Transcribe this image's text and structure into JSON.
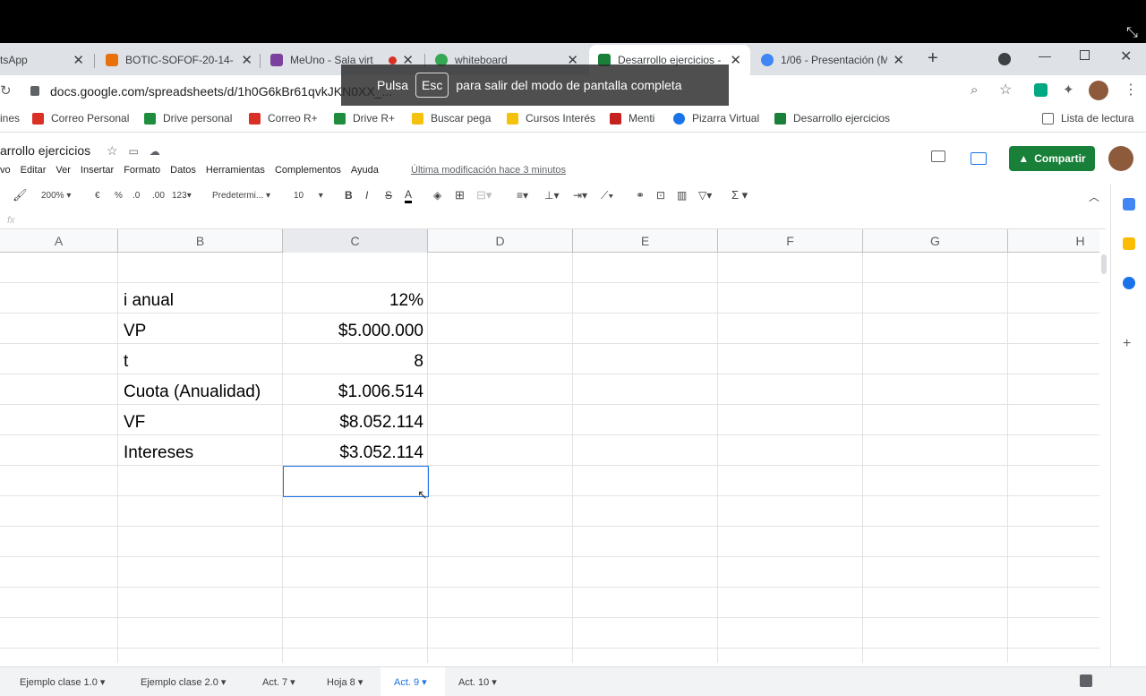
{
  "browser": {
    "exit_fullscreen_icon": "collapse-icon",
    "tabs": [
      {
        "label": "tsApp"
      },
      {
        "label": "BOTIC-SOFOF-20-14-"
      },
      {
        "label": "MeUno - Sala virt"
      },
      {
        "label": "whiteboard"
      },
      {
        "label": "Desarrollo ejercicios -"
      },
      {
        "label": "1/06 - Presentación (M"
      }
    ],
    "new_tab": "+",
    "url": "docs.google.com/spreadsheets/d/1h0G6kBr61qvkJKN0XX_..."
  },
  "bookmarks": [
    {
      "label": "ines"
    },
    {
      "label": "Correo Personal",
      "color": "#d93025"
    },
    {
      "label": "Drive personal",
      "color": "#1e8e3e"
    },
    {
      "label": "Correo R+",
      "color": "#d93025"
    },
    {
      "label": "Drive R+",
      "color": "#1e8e3e"
    },
    {
      "label": "Buscar pega",
      "color": "#f4c20d"
    },
    {
      "label": "Cursos Interés",
      "color": "#f4c20d"
    },
    {
      "label": "Menti",
      "color": "#c5221f"
    },
    {
      "label": "Pizarra Virtual",
      "color": "#1a73e8"
    },
    {
      "label": "Desarrollo ejercicios",
      "color": "#188038"
    },
    {
      "label": "Lista de lectura"
    }
  ],
  "fullscreen_toast": {
    "pre": "Pulsa",
    "key": "Esc",
    "post": "para salir del modo de pantalla completa"
  },
  "doc": {
    "title": "arrollo ejercicios",
    "menu": [
      "vo",
      "Editar",
      "Ver",
      "Insertar",
      "Formato",
      "Datos",
      "Herramientas",
      "Complementos",
      "Ayuda"
    ],
    "last_modified": "Última modificación hace 3 minutos",
    "share_label": "Compartir"
  },
  "toolbar": {
    "zoom": "200%",
    "currency": "€",
    "percent": "%",
    "dec_less": ".0",
    "dec_more": ".00",
    "format_more": "123",
    "font": "Predetermi...",
    "size": "10",
    "bold": "B",
    "italic": "I",
    "strike": "S",
    "textcolor": "A",
    "sum": "Σ"
  },
  "fx_label": "fx",
  "columns": [
    "A",
    "B",
    "C",
    "D",
    "E",
    "F",
    "G",
    "H"
  ],
  "rows": [
    {
      "label": "i anual",
      "value": "12%"
    },
    {
      "label": "VP",
      "value": "$5.000.000"
    },
    {
      "label": "t",
      "value": "8"
    },
    {
      "label": "Cuota (Anualidad)",
      "value": "$1.006.514"
    },
    {
      "label": "VF",
      "value": "$8.052.114"
    },
    {
      "label": "Intereses",
      "value": "$3.052.114"
    }
  ],
  "sheets": [
    {
      "label": "Ejemplo clase 1.0"
    },
    {
      "label": "Ejemplo clase 2.0"
    },
    {
      "label": "Act. 7"
    },
    {
      "label": "Hoja 8"
    },
    {
      "label": "Act. 9",
      "active": true
    },
    {
      "label": "Act. 10"
    }
  ]
}
